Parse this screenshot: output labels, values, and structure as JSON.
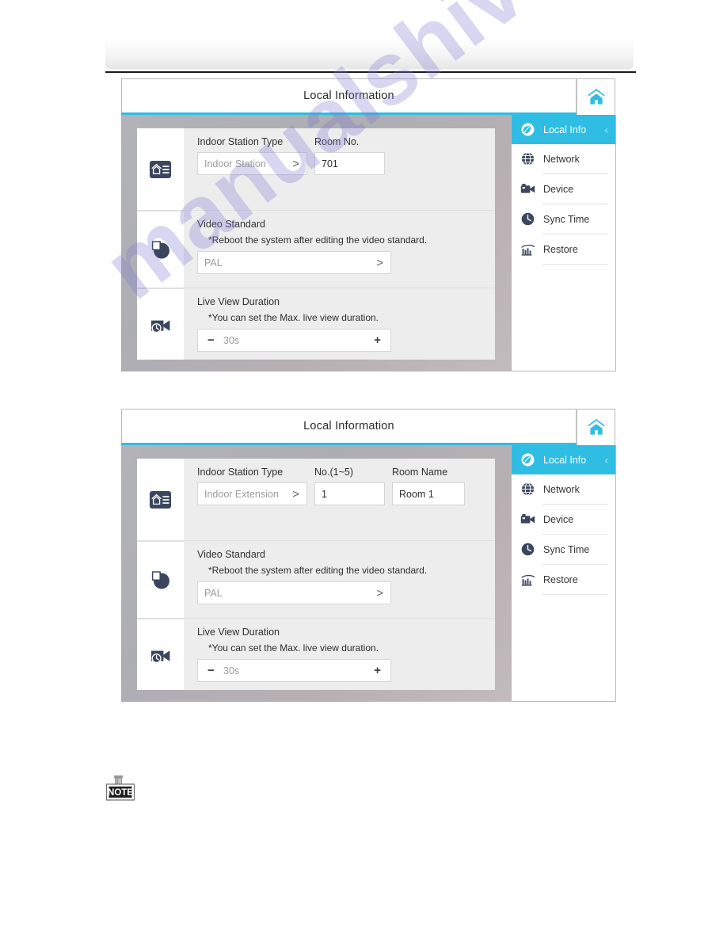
{
  "watermark": {
    "text": "manualshive.com"
  },
  "note": {
    "label": "NOTE"
  },
  "colors": {
    "accent": "#2fbde3",
    "icon_dark": "#3b465e",
    "bezel": "#b2b3b8",
    "screen_bg": "#ededed",
    "placeholder": "#9b9b9b"
  },
  "screens": [
    {
      "title": "Local Information",
      "home_icon": "home-icon",
      "rows": [
        {
          "icon": "indoor-station-icon",
          "fields": [
            {
              "label": "Indoor Station Type",
              "value": "Indoor Station",
              "placeholder": true,
              "chevron": ">",
              "width": "w-select"
            },
            {
              "label": "Room No.",
              "value": "701",
              "placeholder": false,
              "chevron": "",
              "width": "w-room"
            }
          ]
        },
        {
          "icon": "video-standard-icon",
          "label": "Video Standard",
          "hint": "*Reboot the system after editing the video standard.",
          "value": "PAL",
          "placeholder": true,
          "chevron": ">"
        },
        {
          "icon": "live-view-duration-icon",
          "label": "Live View Duration",
          "hint": "*You can set the Max. live view duration.",
          "minus": "−",
          "value": "30s",
          "plus": "+"
        }
      ],
      "nav": [
        {
          "icon": "local-info-icon",
          "label": "Local Info",
          "active": true,
          "back": "‹"
        },
        {
          "icon": "network-icon",
          "label": "Network",
          "active": false
        },
        {
          "icon": "device-icon",
          "label": "Device",
          "active": false
        },
        {
          "icon": "sync-time-icon",
          "label": "Sync Time",
          "active": false
        },
        {
          "icon": "restore-icon",
          "label": "Restore",
          "active": false
        }
      ]
    },
    {
      "title": "Local Information",
      "home_icon": "home-icon",
      "rows": [
        {
          "icon": "indoor-station-icon",
          "fields": [
            {
              "label": "Indoor Station Type",
              "value": "Indoor Extension",
              "placeholder": true,
              "chevron": ">",
              "width": "w-select"
            },
            {
              "label": "No.(1~5)",
              "value": "1",
              "placeholder": false,
              "chevron": "",
              "width": "w-no"
            },
            {
              "label": "Room Name",
              "value": "Room 1",
              "placeholder": false,
              "chevron": "",
              "width": "w-name"
            }
          ]
        },
        {
          "icon": "video-standard-icon",
          "label": "Video Standard",
          "hint": "*Reboot the system after editing the video standard.",
          "value": "PAL",
          "placeholder": true,
          "chevron": ">"
        },
        {
          "icon": "live-view-duration-icon",
          "label": "Live View Duration",
          "hint": "*You can set the Max. live view duration.",
          "minus": "−",
          "value": "30s",
          "plus": "+"
        }
      ],
      "nav": [
        {
          "icon": "local-info-icon",
          "label": "Local Info",
          "active": true,
          "back": "‹"
        },
        {
          "icon": "network-icon",
          "label": "Network",
          "active": false
        },
        {
          "icon": "device-icon",
          "label": "Device",
          "active": false
        },
        {
          "icon": "sync-time-icon",
          "label": "Sync Time",
          "active": false
        },
        {
          "icon": "restore-icon",
          "label": "Restore",
          "active": false
        }
      ]
    }
  ]
}
